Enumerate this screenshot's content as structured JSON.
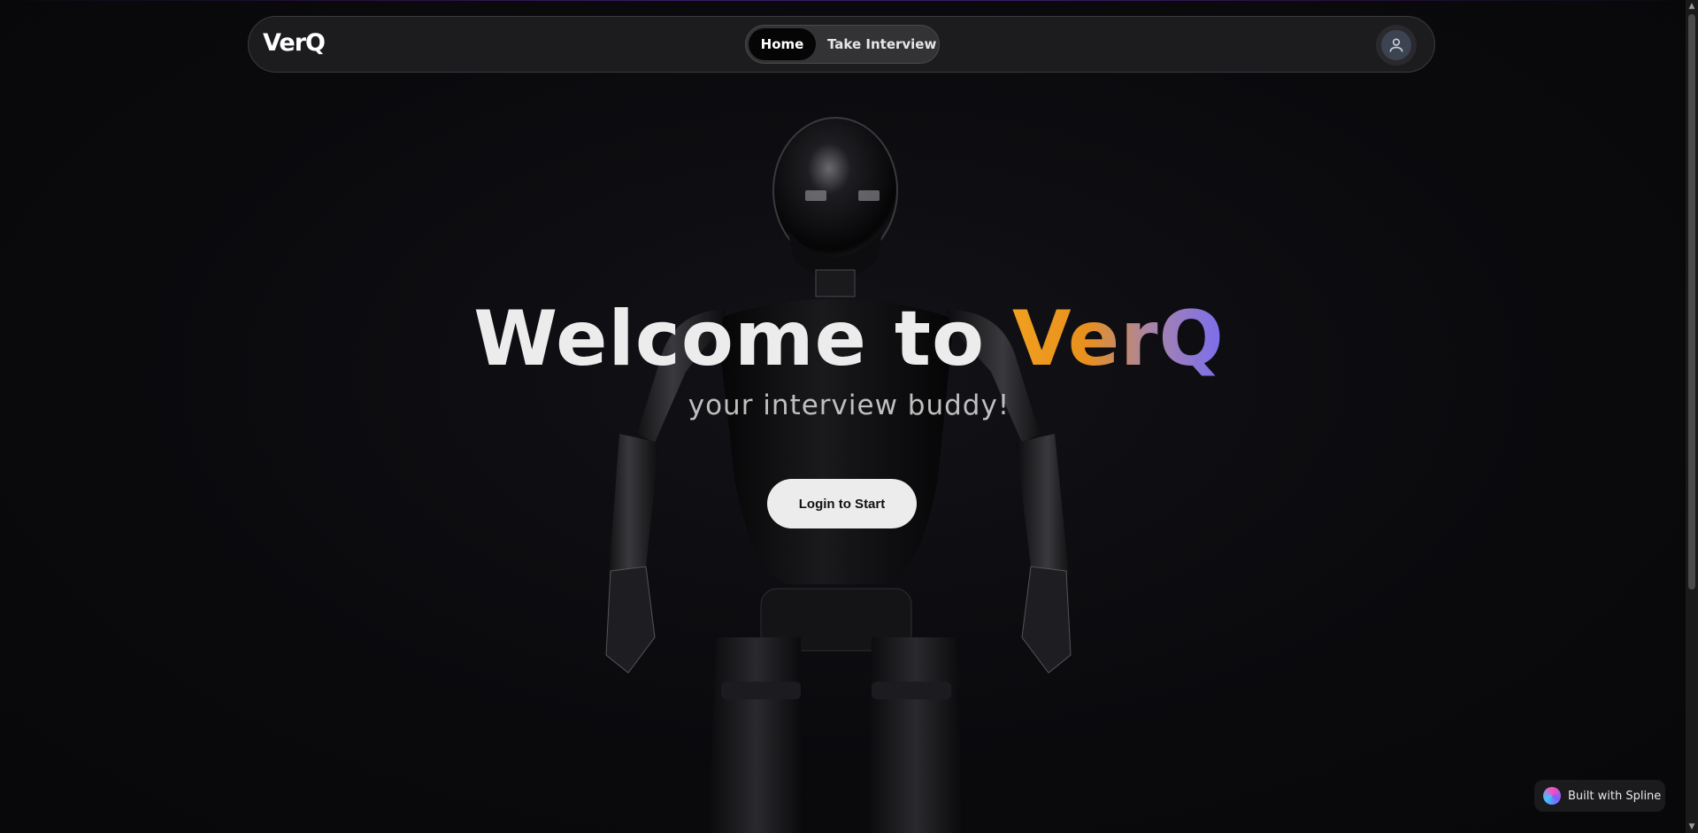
{
  "brand": {
    "logo": "VerQ"
  },
  "nav": {
    "items": [
      {
        "label": "Home",
        "active": true
      },
      {
        "label": "Take Interview",
        "active": false
      }
    ]
  },
  "hero": {
    "title_prefix": "Welcome to ",
    "title_brand": "VerQ",
    "subtitle": "your interview buddy!",
    "cta": "Login to Start"
  },
  "badge": {
    "label": "Built with Spline"
  },
  "colors": {
    "background": "#0b0b0e",
    "navbar": "#1c1c1f",
    "brand_gradient_start": "#f0a020",
    "brand_gradient_end": "#7a6df0",
    "button": "#ececec"
  },
  "icons": {
    "avatar": "user-icon",
    "spline": "spline-logo-icon",
    "scroll_up": "chevron-up-icon",
    "scroll_down": "chevron-down-icon"
  }
}
